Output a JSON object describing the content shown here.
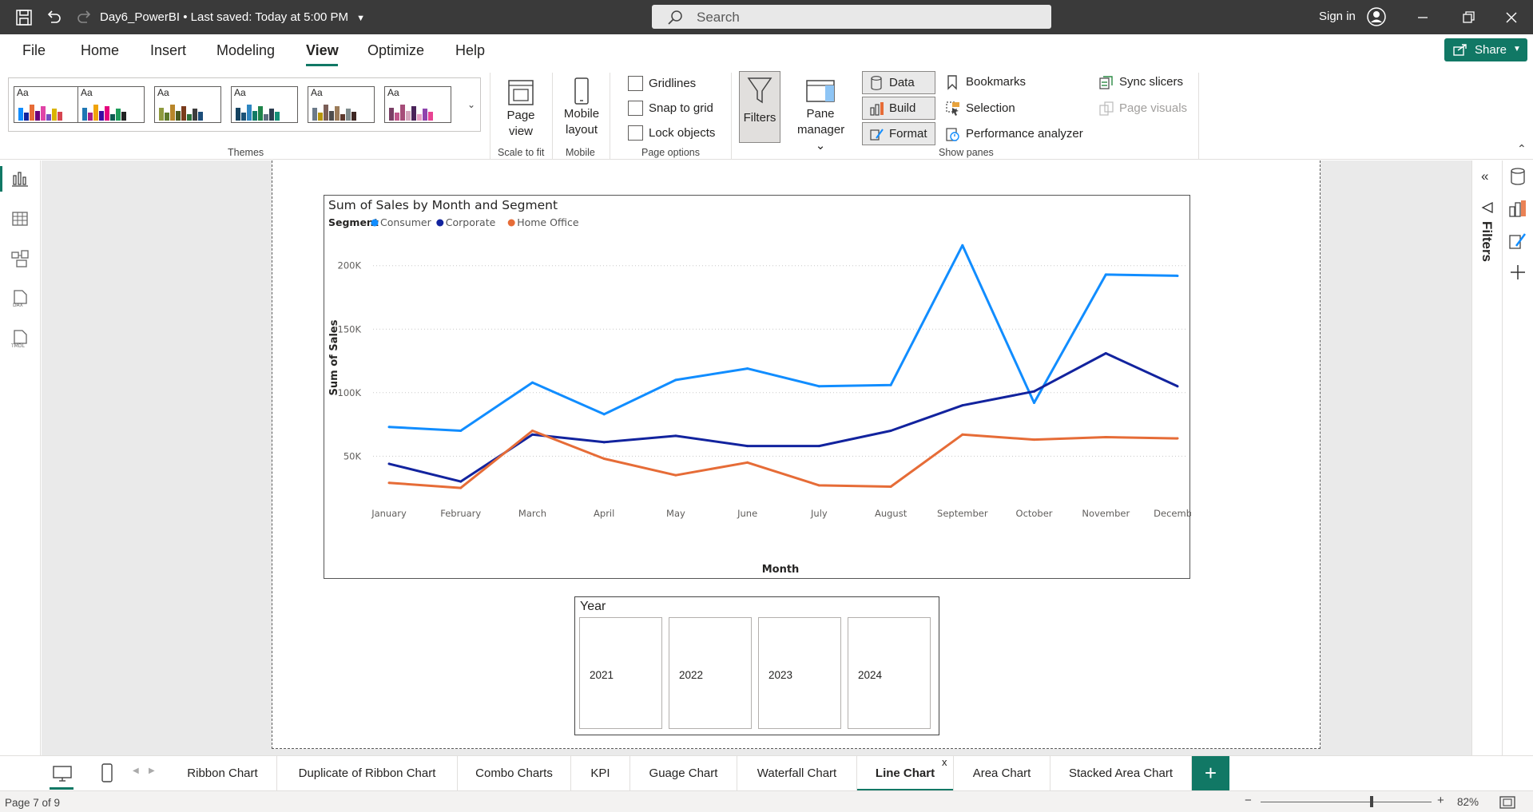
{
  "titlebar": {
    "file_name": "Day6_PowerBI",
    "save_status": "Last saved: Today at 5:00 PM",
    "search_placeholder": "Search",
    "signin": "Sign in"
  },
  "menu": {
    "items": [
      "File",
      "Home",
      "Insert",
      "Modeling",
      "View",
      "Optimize",
      "Help"
    ],
    "active": "View",
    "share": "Share"
  },
  "ribbon": {
    "themes_label": "Themes",
    "theme_sample": "Aa",
    "page_view": "Page view",
    "scale_to_fit": "Scale to fit",
    "mobile_layout_1": "Mobile",
    "mobile_layout_2": "layout",
    "mobile_group": "Mobile",
    "gridlines": "Gridlines",
    "snap_to_grid": "Snap to grid",
    "lock_objects": "Lock objects",
    "page_options": "Page options",
    "filters": "Filters",
    "pane_manager_1": "Pane",
    "pane_manager_2": "manager",
    "data": "Data",
    "build": "Build",
    "format": "Format",
    "bookmarks": "Bookmarks",
    "selection": "Selection",
    "performance_analyzer": "Performance analyzer",
    "sync_slicers": "Sync slicers",
    "page_visuals": "Page visuals",
    "show_panes": "Show panes"
  },
  "colors": {
    "accent": "#117865",
    "consumer": "#118dff",
    "corporate": "#12239e",
    "home_office": "#e66c37"
  },
  "chart_data": {
    "type": "line",
    "title": "Sum of Sales by Month and Segment",
    "legend_title": "Segment",
    "legend_position": "top-left",
    "xlabel": "Month",
    "ylabel": "Sum of Sales",
    "categories": [
      "January",
      "February",
      "March",
      "April",
      "May",
      "June",
      "July",
      "August",
      "September",
      "October",
      "November",
      "December"
    ],
    "yticks": [
      50000,
      100000,
      150000,
      200000
    ],
    "ytick_labels": [
      "50K",
      "100K",
      "150K",
      "200K"
    ],
    "ylim": [
      15000,
      230000
    ],
    "grid": true,
    "series": [
      {
        "name": "Consumer",
        "color": "#118dff",
        "values": [
          73000,
          70000,
          108000,
          83000,
          110000,
          119000,
          105000,
          106000,
          216000,
          92000,
          193000,
          192000
        ]
      },
      {
        "name": "Corporate",
        "color": "#12239e",
        "values": [
          44000,
          30000,
          67000,
          61000,
          66000,
          58000,
          58000,
          70000,
          90000,
          101000,
          131000,
          105000
        ]
      },
      {
        "name": "Home Office",
        "color": "#e66c37",
        "values": [
          29000,
          25000,
          70000,
          48000,
          35000,
          45000,
          27000,
          26000,
          67000,
          63000,
          65000,
          64000
        ]
      }
    ]
  },
  "slicer": {
    "title": "Year",
    "options": [
      "2021",
      "2022",
      "2023",
      "2024"
    ]
  },
  "filters_pane_label": "Filters",
  "tabs": {
    "items": [
      "Ribbon Chart",
      "Duplicate of Ribbon Chart",
      "Combo Charts",
      "KPI",
      "Guage Chart",
      "Waterfall Chart",
      "Line Chart",
      "Area Chart",
      "Stacked Area Chart"
    ],
    "active": "Line Chart",
    "close": "x",
    "add": "+"
  },
  "status": {
    "page": "Page 7 of 9",
    "zoom": "82%"
  }
}
